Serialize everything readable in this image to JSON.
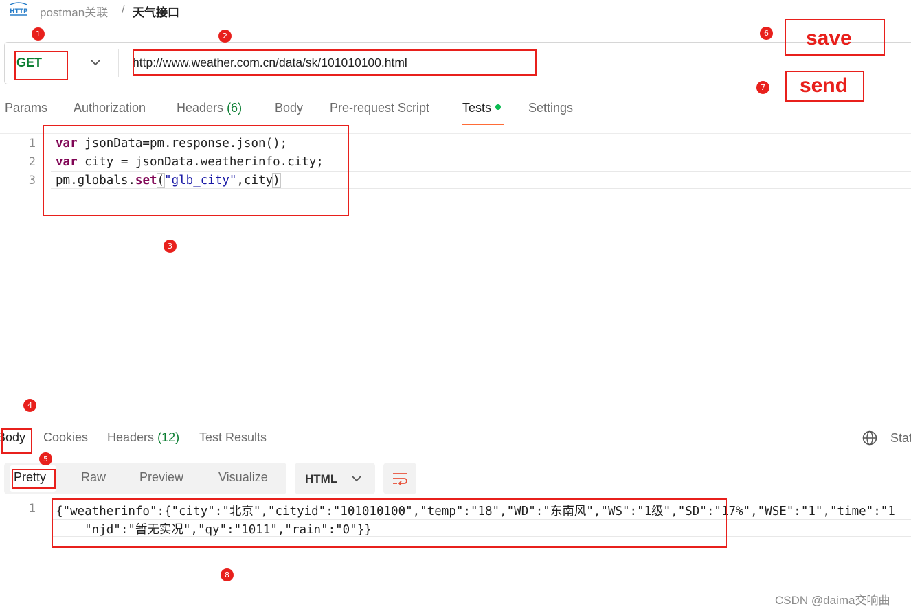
{
  "breadcrumb": {
    "icon": "http-icon",
    "parent": "postman关联",
    "separator": "/",
    "title": "天气接口"
  },
  "request": {
    "method": "GET",
    "url": "http://www.weather.com.cn/data/sk/101010100.html"
  },
  "request_tabs": [
    {
      "label": "Params"
    },
    {
      "label": "Authorization"
    },
    {
      "label": "Headers",
      "count": "(6)"
    },
    {
      "label": "Body"
    },
    {
      "label": "Pre-request Script"
    },
    {
      "label": "Tests",
      "active": true
    },
    {
      "label": "Settings"
    }
  ],
  "tests_code": {
    "line_numbers": [
      "1",
      "2",
      "3"
    ],
    "line1": {
      "kw": "var",
      "rest": " jsonData=pm.response.json();"
    },
    "line2": {
      "kw": "var",
      "rest": " city = jsonData.weatherinfo.city;"
    },
    "line3": {
      "pre": "pm.globals.",
      "fn": "set",
      "open": "(",
      "str": "\"glb_city\"",
      "mid": ",city",
      "close": ")"
    }
  },
  "response_tabs": [
    {
      "label": "Body",
      "active": true
    },
    {
      "label": "Cookies"
    },
    {
      "label": "Headers",
      "count": "(12)"
    },
    {
      "label": "Test Results"
    }
  ],
  "response_status_label": "Stat",
  "view_modes": [
    "Pretty",
    "Raw",
    "Preview",
    "Visualize"
  ],
  "format": "HTML",
  "response_body": {
    "line_number": "1",
    "line1": "{\"weatherinfo\":{\"city\":\"北京\",\"cityid\":\"101010100\",\"temp\":\"18\",\"WD\":\"东南风\",\"WS\":\"1级\",\"SD\":\"17%\",\"WSE\":\"1\",\"time\":\"1",
    "line2": "    \"njd\":\"暂无实况\",\"qy\":\"1011\",\"rain\":\"0\"}}"
  },
  "annotations": {
    "badges": [
      "1",
      "2",
      "3",
      "4",
      "5",
      "6",
      "7",
      "8"
    ],
    "save_label": "save",
    "send_label": "send"
  },
  "watermark": "CSDN @daima交响曲",
  "colors": {
    "accent": "#ff6c37",
    "method_green": "#0a7d31",
    "annotation_red": "#e8201c"
  }
}
